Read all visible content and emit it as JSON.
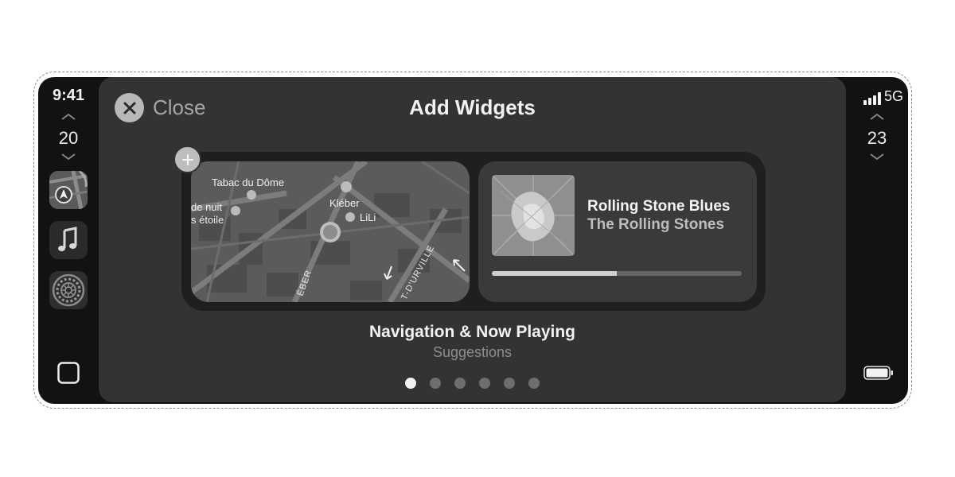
{
  "status": {
    "time": "9:41",
    "network": "5G"
  },
  "climate": {
    "left_temp": "20",
    "right_temp": "23"
  },
  "dock": {
    "apps": [
      {
        "name": "Maps",
        "icon": "maps-icon"
      },
      {
        "name": "Music",
        "icon": "music-note-icon"
      },
      {
        "name": "Settings",
        "icon": "gear-icon"
      }
    ],
    "home_icon": "home-square-icon"
  },
  "header": {
    "close_label": "Close",
    "title": "Add Widgets"
  },
  "widget": {
    "name": "Navigation & Now Playing",
    "subtitle": "Suggestions",
    "map": {
      "labels": [
        "Tabac du Dôme",
        "de nuit",
        "s étoile",
        "Kléber",
        "LiLi",
        "T-D'URVILLE",
        "ÉBER"
      ]
    },
    "now_playing": {
      "title": "Rolling Stone Blues",
      "artist": "The Rolling Stones",
      "progress": 0.5
    }
  },
  "pagination": {
    "count": 6,
    "active_index": 0
  },
  "colors": {
    "panel": "#333333",
    "tray": "#1f1f1f",
    "accent_light": "#f2f2f2"
  }
}
